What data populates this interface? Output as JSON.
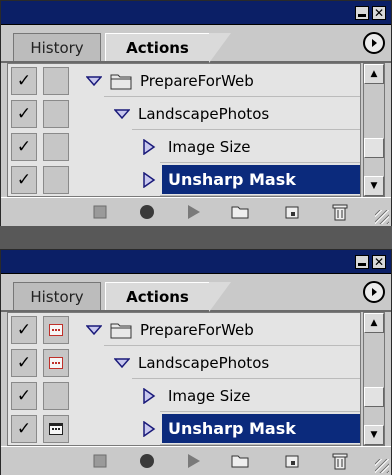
{
  "panels": [
    {
      "tabs": [
        {
          "label": "History",
          "active": false
        },
        {
          "label": "Actions",
          "active": true
        }
      ],
      "rows": [
        {
          "label": "PrepareForWeb",
          "checked": true,
          "dialog": "none",
          "type": "set",
          "selected": false
        },
        {
          "label": "LandscapePhotos",
          "checked": true,
          "dialog": "none",
          "type": "action",
          "selected": false
        },
        {
          "label": "Image Size",
          "checked": true,
          "dialog": "none",
          "type": "command",
          "selected": false
        },
        {
          "label": "Unsharp Mask",
          "checked": true,
          "dialog": "none",
          "type": "command",
          "selected": true
        }
      ]
    },
    {
      "tabs": [
        {
          "label": "History",
          "active": false
        },
        {
          "label": "Actions",
          "active": true
        }
      ],
      "rows": [
        {
          "label": "PrepareForWeb",
          "checked": true,
          "dialog": "partial",
          "type": "set",
          "selected": false
        },
        {
          "label": "LandscapePhotos",
          "checked": true,
          "dialog": "partial",
          "type": "action",
          "selected": false
        },
        {
          "label": "Image Size",
          "checked": true,
          "dialog": "none",
          "type": "command",
          "selected": false
        },
        {
          "label": "Unsharp Mask",
          "checked": true,
          "dialog": "on",
          "type": "command",
          "selected": true
        }
      ]
    }
  ],
  "toolbar": {
    "icons": [
      "stop-icon",
      "record-icon",
      "play-icon",
      "new-set-icon",
      "new-action-icon",
      "trash-icon"
    ]
  },
  "colors": {
    "titlebar": "#0b1f66",
    "selection": "#0b2a7c",
    "panel_bg": "#c9c9c9",
    "dialog_partial": "#c0302a"
  }
}
